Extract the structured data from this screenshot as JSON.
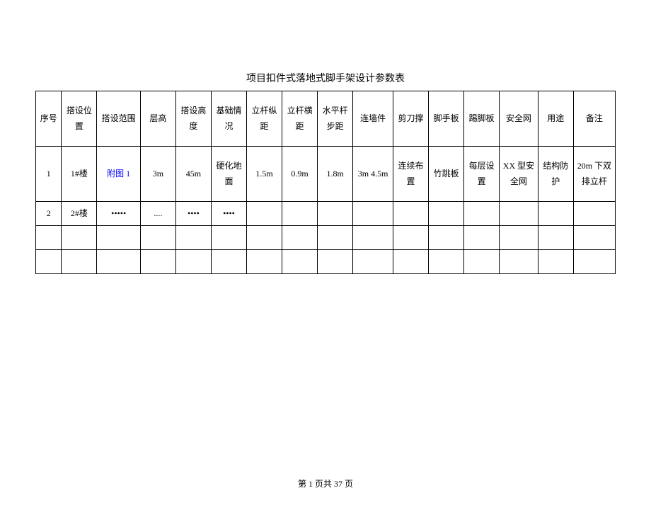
{
  "title": "项目扣件式落地式脚手架设计参数表",
  "headers": [
    "序号",
    "搭设位置",
    "搭设范围",
    "层高",
    "搭设高度",
    "基础情况",
    "立杆纵距",
    "立杆横距",
    "水平杆步距",
    "连墙件",
    "剪刀撑",
    "脚手板",
    "踢脚板",
    "安全网",
    "用途",
    "备注"
  ],
  "rows": [
    {
      "cells": [
        "1",
        "1#楼",
        "附图 1",
        "3m",
        "45m",
        "硬化地面",
        "1.5m",
        "0.9m",
        "1.8m",
        "3m 4.5m",
        "连续布置",
        "竹跳板",
        "每层设置",
        "XX 型安全网",
        "结构防护",
        "20m 下双排立杆"
      ],
      "link_col": 2,
      "class": "row-data"
    },
    {
      "cells": [
        "2",
        "2#楼",
        "•••••",
        "....",
        "••••",
        "••••",
        "",
        "",
        "",
        "",
        "",
        "",
        "",
        "",
        "",
        ""
      ],
      "link_col": -1,
      "class": "row-short"
    },
    {
      "cells": [
        "",
        "",
        "",
        "",
        "",
        "",
        "",
        "",
        "",
        "",
        "",
        "",
        "",
        "",
        "",
        ""
      ],
      "link_col": -1,
      "class": "row-empty"
    },
    {
      "cells": [
        "",
        "",
        "",
        "",
        "",
        "",
        "",
        "",
        "",
        "",
        "",
        "",
        "",
        "",
        "",
        ""
      ],
      "link_col": -1,
      "class": "row-empty"
    }
  ],
  "footer": "第 1 页共 37 页"
}
